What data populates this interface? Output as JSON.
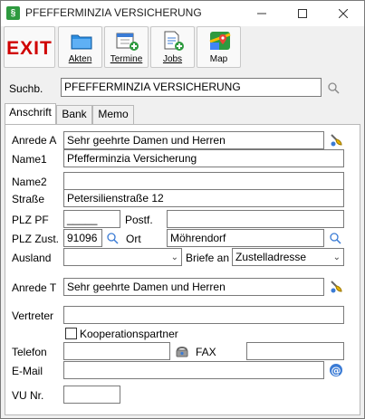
{
  "window": {
    "title": "PFEFFERMINZIA VERSICHERUNG",
    "app_icon": "§"
  },
  "toolbar": {
    "exit_label": "EXIT",
    "akten_label": "Akten",
    "termine_label": "Termine",
    "jobs_label": "Jobs",
    "map_label": "Map"
  },
  "search": {
    "label": "Suchb.",
    "value": "PFEFFERMINZIA VERSICHERUNG"
  },
  "tabs": [
    "Anschrift",
    "Bank",
    "Memo"
  ],
  "form": {
    "anrede_a_label": "Anrede A",
    "anrede_a_value": "Sehr geehrte Damen und Herren",
    "name1_label": "Name1",
    "name1_value": "Pfefferminzia Versicherung",
    "name2_label": "Name2",
    "name2_value": "",
    "strasse_label": "Straße",
    "strasse_value": "Petersilienstraße 12",
    "plz_pf_label": "PLZ PF",
    "plz_pf_value": "_____",
    "postf_label": "Postf.",
    "postf_value": "",
    "plz_zust_label": "PLZ Zust.",
    "plz_zust_value": "91096",
    "ort_label": "Ort",
    "ort_value": "Möhrendorf",
    "ausland_label": "Ausland",
    "ausland_value": "",
    "briefe_an_label": "Briefe an",
    "briefe_an_value": "Zustelladresse",
    "anrede_t_label": "Anrede T",
    "anrede_t_value": "Sehr geehrte Damen und Herren",
    "vertreter_label": "Vertreter",
    "vertreter_value": "",
    "kooperation_label": "Kooperationspartner",
    "kooperation_checked": false,
    "telefon_label": "Telefon",
    "telefon_value": "",
    "fax_label": "FAX",
    "fax_value": "",
    "email_label": "E-Mail",
    "email_value": "",
    "vu_nr_label": "VU Nr.",
    "vu_nr_value": ""
  },
  "colors": {
    "exit_red": "#d00000",
    "map_green": "#2e9a3f"
  }
}
